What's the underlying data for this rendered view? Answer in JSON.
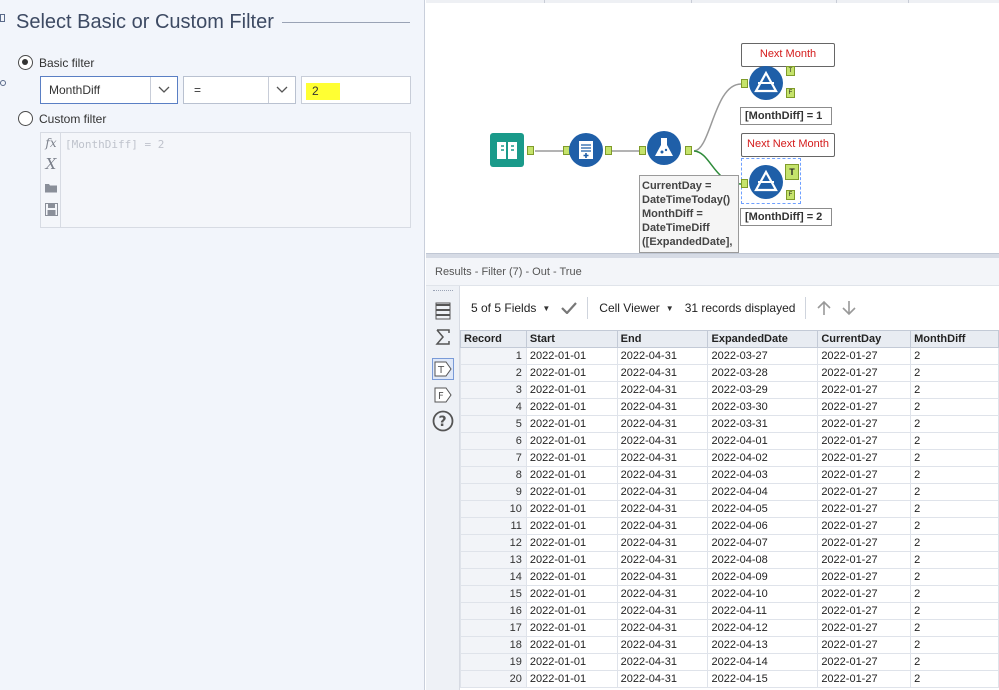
{
  "filter_panel": {
    "title": "Select Basic or Custom Filter",
    "basic_label": "Basic filter",
    "field_value": "MonthDiff",
    "operator_value": "=",
    "value_input": "2",
    "custom_label": "Custom filter",
    "custom_expression": "[MonthDiff] = 2",
    "selected_mode": "basic"
  },
  "canvas": {
    "next_month_label": "Next Month",
    "next_next_month_label": "Next Next Month",
    "filter1_expression": "[MonthDiff] = 1",
    "filter2_expression": "[MonthDiff] = 2",
    "true_anchor": "T",
    "false_anchor": "F",
    "formula_lines": [
      "CurrentDay =",
      "DateTimeToday()",
      "MonthDiff =",
      "DateTimeDiff",
      "([ExpandedDate],"
    ]
  },
  "results": {
    "title": "Results - Filter (7) - Out - True",
    "fields_label": "5 of 5 Fields",
    "viewer_label": "Cell Viewer",
    "records_label": "31 records displayed",
    "columns": [
      "Record",
      "Start",
      "End",
      "ExpandedDate",
      "CurrentDay",
      "MonthDiff"
    ],
    "rows": [
      [
        "1",
        "2022-01-01",
        "2022-04-31",
        "2022-03-27",
        "2022-01-27",
        "2"
      ],
      [
        "2",
        "2022-01-01",
        "2022-04-31",
        "2022-03-28",
        "2022-01-27",
        "2"
      ],
      [
        "3",
        "2022-01-01",
        "2022-04-31",
        "2022-03-29",
        "2022-01-27",
        "2"
      ],
      [
        "4",
        "2022-01-01",
        "2022-04-31",
        "2022-03-30",
        "2022-01-27",
        "2"
      ],
      [
        "5",
        "2022-01-01",
        "2022-04-31",
        "2022-03-31",
        "2022-01-27",
        "2"
      ],
      [
        "6",
        "2022-01-01",
        "2022-04-31",
        "2022-04-01",
        "2022-01-27",
        "2"
      ],
      [
        "7",
        "2022-01-01",
        "2022-04-31",
        "2022-04-02",
        "2022-01-27",
        "2"
      ],
      [
        "8",
        "2022-01-01",
        "2022-04-31",
        "2022-04-03",
        "2022-01-27",
        "2"
      ],
      [
        "9",
        "2022-01-01",
        "2022-04-31",
        "2022-04-04",
        "2022-01-27",
        "2"
      ],
      [
        "10",
        "2022-01-01",
        "2022-04-31",
        "2022-04-05",
        "2022-01-27",
        "2"
      ],
      [
        "11",
        "2022-01-01",
        "2022-04-31",
        "2022-04-06",
        "2022-01-27",
        "2"
      ],
      [
        "12",
        "2022-01-01",
        "2022-04-31",
        "2022-04-07",
        "2022-01-27",
        "2"
      ],
      [
        "13",
        "2022-01-01",
        "2022-04-31",
        "2022-04-08",
        "2022-01-27",
        "2"
      ],
      [
        "14",
        "2022-01-01",
        "2022-04-31",
        "2022-04-09",
        "2022-01-27",
        "2"
      ],
      [
        "15",
        "2022-01-01",
        "2022-04-31",
        "2022-04-10",
        "2022-01-27",
        "2"
      ],
      [
        "16",
        "2022-01-01",
        "2022-04-31",
        "2022-04-11",
        "2022-01-27",
        "2"
      ],
      [
        "17",
        "2022-01-01",
        "2022-04-31",
        "2022-04-12",
        "2022-01-27",
        "2"
      ],
      [
        "18",
        "2022-01-01",
        "2022-04-31",
        "2022-04-13",
        "2022-01-27",
        "2"
      ],
      [
        "19",
        "2022-01-01",
        "2022-04-31",
        "2022-04-14",
        "2022-01-27",
        "2"
      ],
      [
        "20",
        "2022-01-01",
        "2022-04-31",
        "2022-04-15",
        "2022-01-27",
        "2"
      ]
    ]
  },
  "colors": {
    "accent_blue": "#1f5fa8",
    "highlight_yellow": "#ffff33",
    "container_title_red": "#d41a1a",
    "anchor_green": "#c5e36b",
    "input_tool_teal": "#1a9a8a"
  },
  "icons": {
    "input_tool": "book-icon",
    "select_tool": "table-list-icon",
    "formula_tool": "flask-icon",
    "filter_tool": "triangle-filter-icon"
  }
}
